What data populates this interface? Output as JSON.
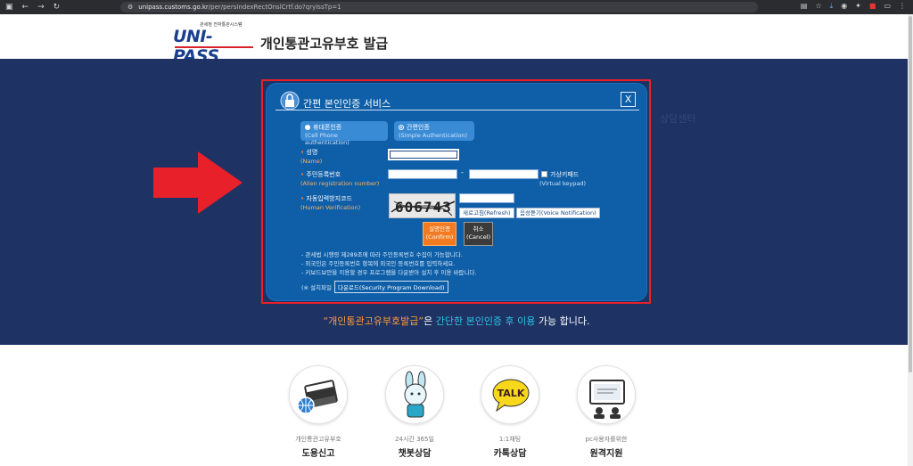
{
  "browser": {
    "url_host": "unipass.customs.go.kr",
    "url_path": "/per/persIndexRectOnslCrtf.do?qryIssTp=1"
  },
  "header": {
    "logo_sub": "관세청 전자통관시스템",
    "logo_mark": "UNI-PASS",
    "page_title": "개인통관고유부호 발급"
  },
  "hero_ghost_text": [
    "",
    "",
    "상담센터",
    ""
  ],
  "modal": {
    "title": "간편 본인인증 서비스",
    "close_label": "X",
    "auth_options": [
      {
        "ko": "휴대폰인증",
        "en": "(Cell Phone authentication)",
        "selected": true
      },
      {
        "ko": "간편인증",
        "en": "(Simple Authentication)",
        "selected": false
      }
    ],
    "name_label": "성명",
    "name_label_en": "(Name)",
    "alien_label": "주민등록번호",
    "alien_label_en": "(Alien registration number)",
    "dash": "-",
    "keypad_label": "가상키패드",
    "keypad_label_en": "(Virtual keypad)",
    "captcha_label": "자동입력방지코드",
    "captcha_label_en": "(Human Verification)",
    "captcha_text": "606743",
    "refresh_label": "새로고침(Refresh)",
    "voice_label": "음성듣기(Voice Notification)",
    "confirm_ko": "실명인증",
    "confirm_en": "(Confirm)",
    "cancel_ko": "취소",
    "cancel_en": "(Cancel)",
    "notes": [
      "- 관세법 시행령 제289조에 따라 주민등록번호 수집이 가능합니다.",
      "- 외국인은 주민등록번호 항목에 외국인 등록번호를 입력하세요.",
      "- 키보드보안을 이용할 경우 프로그램을 다운받아 설치 후 이용 바랍니다."
    ],
    "install_label": "(※ 설치파일",
    "download_label": "다운로드(Security Program Download)"
  },
  "tagline": {
    "part1": "“개인통관고유부호발급”",
    "part2": "은 ",
    "part3": "간단한 본인인증 후 이용",
    "part4": " 가능 합니다."
  },
  "services": [
    {
      "sub": "개인통관고유부호",
      "main": "도용신고",
      "icon": "unipass-book-icon"
    },
    {
      "sub": "24시간 365일",
      "main": "챗봇상담",
      "icon": "chatbot-rabbit-icon"
    },
    {
      "sub": "1:1채팅",
      "main": "카톡상담",
      "icon": "kakao-talk-icon"
    },
    {
      "sub": "pc사용자를위한",
      "main": "원격지원",
      "icon": "remote-support-icon"
    }
  ],
  "talk_text": "TALK",
  "colors": {
    "hero_bg": "#1e3263",
    "modal_bg": "#0f5fa8",
    "accent_orange": "#f37a1f",
    "highlight_red": "#e8202a"
  }
}
